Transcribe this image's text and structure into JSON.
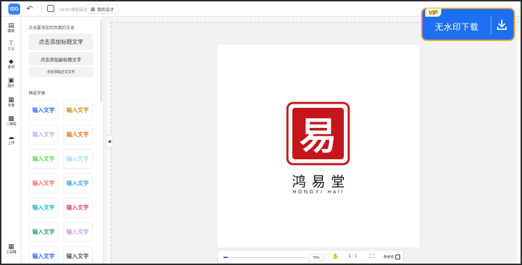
{
  "topbar": {
    "logo_text": "iDG",
    "undo_icon": "undo-icon",
    "save_status": "14:30 保存成功",
    "mydesign_label": "我的设计"
  },
  "rail": [
    {
      "icon": "template-icon",
      "label": "模板",
      "glyph": "▤"
    },
    {
      "icon": "text-icon",
      "label": "文本",
      "glyph": "T",
      "active": true
    },
    {
      "icon": "material-icon",
      "label": "素材",
      "glyph": "◆"
    },
    {
      "icon": "image-icon",
      "label": "图片",
      "glyph": "▣"
    },
    {
      "icon": "background-icon",
      "label": "背景",
      "glyph": "▦"
    },
    {
      "icon": "qrcode-icon",
      "label": "二维码",
      "glyph": "▩"
    },
    {
      "icon": "upload-icon",
      "label": "上传",
      "glyph": "☁"
    },
    {
      "icon": "toolbox-icon",
      "label": "工具箱",
      "glyph": "▦"
    }
  ],
  "panel": {
    "hint": "点击要添加到页面的文本",
    "add_title": "点击添加标题文字",
    "add_subtitle": "点击添加副标题文字",
    "add_body": "点击添加正文文字",
    "preset_label": "预设字体",
    "presets": [
      {
        "text": "输入文字",
        "color": "#2b6ef2"
      },
      {
        "text": "输入文字",
        "color": "#c8901a"
      },
      {
        "text": "输入文字",
        "color": "#b9b3f0"
      },
      {
        "text": "输入文字",
        "color": "#e8741a"
      },
      {
        "text": "输入文字",
        "color": "#5fd35f"
      },
      {
        "text": "输入文字",
        "color": "#9fdff0"
      },
      {
        "text": "输入文字",
        "color": "#f2706a"
      },
      {
        "text": "输入文字",
        "color": "#3aa8e6"
      },
      {
        "text": "输入文字",
        "color": "#21b6c2"
      },
      {
        "text": "输入文字",
        "color": "#e83a78"
      },
      {
        "text": "输入文字",
        "color": "#2a9a7a"
      },
      {
        "text": "输入文字",
        "color": "#c9a0e8"
      },
      {
        "text": "输入文字",
        "color": "#2b6ef2"
      },
      {
        "text": "输入文字",
        "color": "#555555"
      }
    ]
  },
  "canvas": {
    "seal_char": "易",
    "brand_name": "鸿易堂",
    "brand_en": "HONGYI Hall",
    "seal_color": "#c4161c"
  },
  "bottombar": {
    "zoom_percent": "75%",
    "zoom_fraction": 0.05,
    "ratio_label": "1 : 1",
    "guides_label": "参考线"
  },
  "vip": {
    "badge": "VIP",
    "label": "无水印下载",
    "accent": "#1d6ff2",
    "border": "#f0a33a"
  }
}
